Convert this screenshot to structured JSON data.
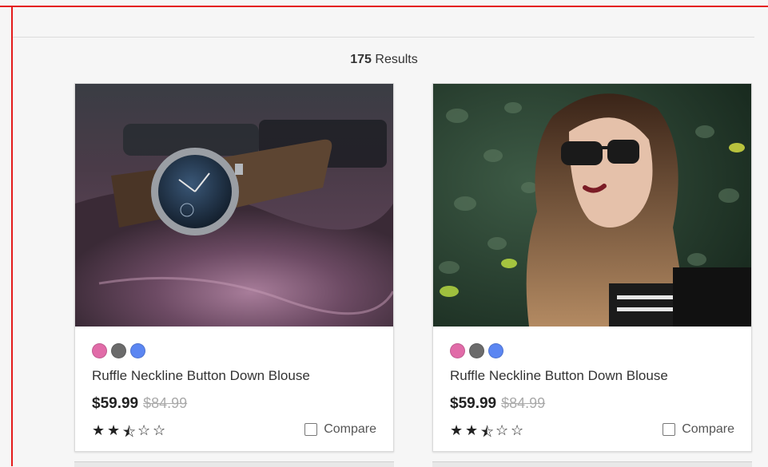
{
  "results": {
    "count": "175",
    "label": " Results"
  },
  "products": [
    {
      "image_subject": "wristwatch-on-leather-bag",
      "swatches": [
        "#e16ba8",
        "#6b6b6b",
        "#5b86f2"
      ],
      "title": "Ruffle Neckline Button Down Blouse",
      "price": "$59.99",
      "original_price": "$84.99",
      "rating": 2.5,
      "max_rating": 5,
      "compare_label": "Compare"
    },
    {
      "image_subject": "woman-in-sunglasses-by-hedge",
      "swatches": [
        "#e16ba8",
        "#6b6b6b",
        "#5b86f2"
      ],
      "title": "Ruffle Neckline Button Down Blouse",
      "price": "$59.99",
      "original_price": "$84.99",
      "rating": 2.5,
      "max_rating": 5,
      "compare_label": "Compare"
    }
  ],
  "colors": {
    "frame": "#e41b1b",
    "background": "#f6f6f6"
  }
}
